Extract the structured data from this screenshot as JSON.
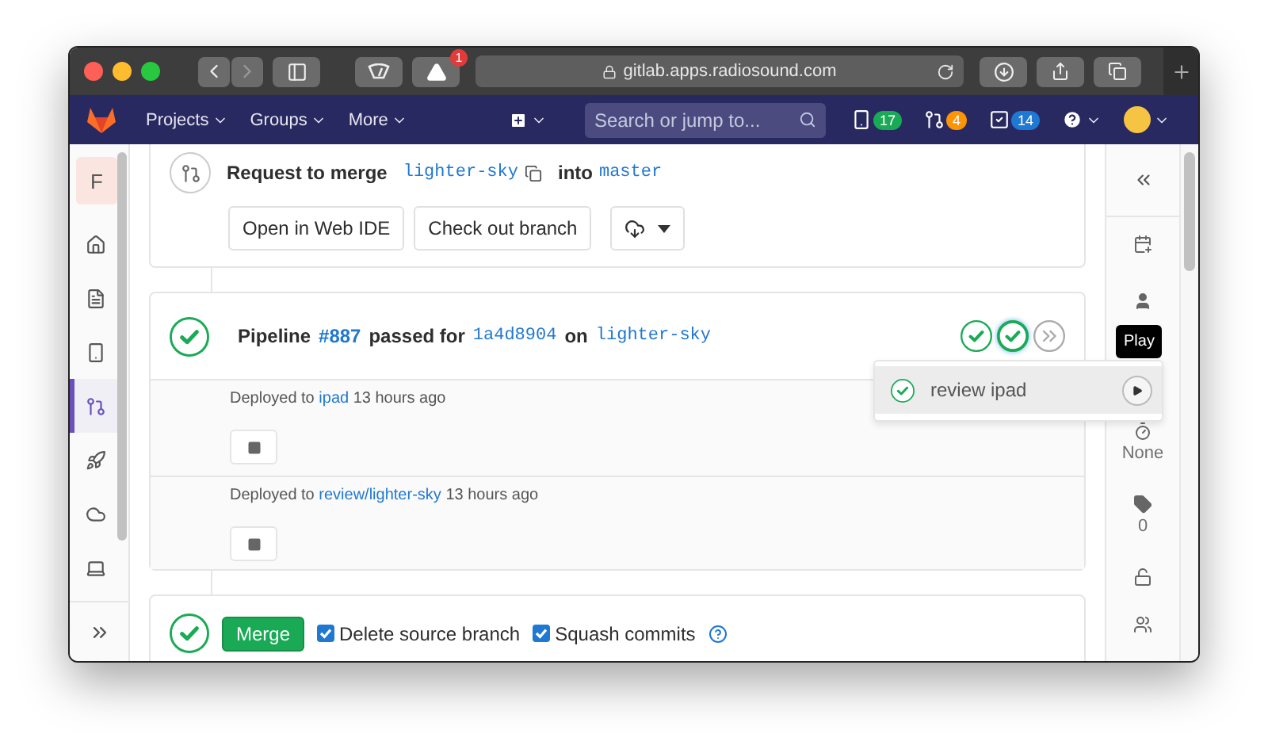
{
  "browser": {
    "url": "gitlab.apps.radiosound.com",
    "alert_badge": "1"
  },
  "nav": {
    "menus": [
      "Projects",
      "Groups",
      "More"
    ],
    "search": {
      "placeholder": "Search or jump to..."
    },
    "counters": [
      {
        "kind": "issues",
        "value": "17",
        "color": "#1aaa55"
      },
      {
        "kind": "merge",
        "value": "4",
        "color": "#fc9403"
      },
      {
        "kind": "todos",
        "value": "14",
        "color": "#1f78d1"
      }
    ]
  },
  "sidebar": {
    "project_letter": "F",
    "items": [
      {
        "kind": "home",
        "selected": false
      },
      {
        "kind": "file",
        "selected": false
      },
      {
        "kind": "issues",
        "selected": false
      },
      {
        "kind": "merge",
        "selected": true
      },
      {
        "kind": "rocket",
        "selected": false
      },
      {
        "kind": "cloud",
        "selected": false
      },
      {
        "kind": "laptop",
        "selected": false
      }
    ]
  },
  "merge_request": {
    "title": "Request to merge",
    "source_branch": "lighter-sky",
    "joiner": "into",
    "target_branch": "master",
    "buttons": [
      "Open in Web IDE",
      "Check out branch"
    ]
  },
  "pipeline": {
    "label": "Pipeline",
    "number": "#887",
    "passed": "passed for",
    "commit": "1a4d8904",
    "on": "on",
    "branch": "lighter-sky",
    "stages": [
      {
        "kind": "passed",
        "selected": false
      },
      {
        "kind": "passed",
        "selected": true
      },
      {
        "kind": "skipped",
        "selected": false
      }
    ]
  },
  "deployments": [
    {
      "prefix": "Deployed to",
      "environment": "ipad",
      "time": "13 hours ago"
    },
    {
      "prefix": "Deployed to",
      "environment": "review/lighter-sky",
      "time": "13 hours ago"
    }
  ],
  "stage_dropdown": {
    "job": "review ipad",
    "tooltip": "Play"
  },
  "merge": {
    "button": "Merge",
    "options": [
      {
        "label": "Delete source branch",
        "checked": true
      },
      {
        "label": "Squash commits",
        "checked": true
      }
    ]
  },
  "right_sidebar": {
    "time_tracking": "None",
    "labels": "0"
  }
}
